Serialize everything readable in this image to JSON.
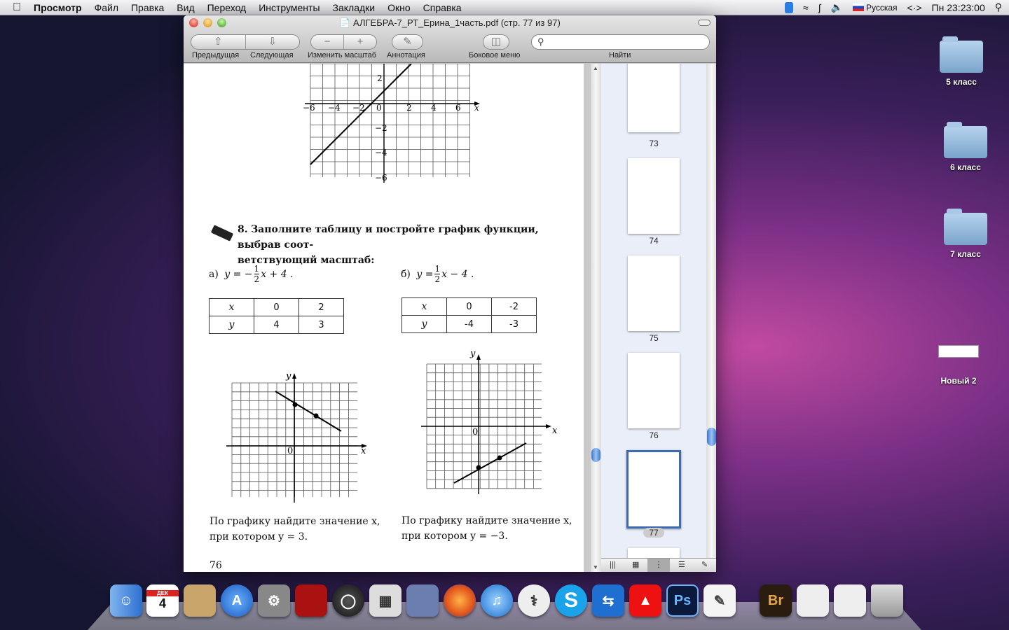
{
  "menubar": {
    "apple": "",
    "items": [
      "Просмотр",
      "Файл",
      "Правка",
      "Вид",
      "Переход",
      "Инструменты",
      "Закладки",
      "Окно",
      "Справка"
    ],
    "input_source": "Русская",
    "clock": "Пн 23:23:00"
  },
  "window": {
    "title": "АЛГЕБРА-7_РТ_Ерина_1часть.pdf (стр. 77 из 97)",
    "toolbar": {
      "prev": "Предыдущая",
      "next": "Следующая",
      "zoom": "Изменить масштаб",
      "annotate": "Аннотация",
      "sidebar": "Боковое меню",
      "find": "Найти",
      "search_value": ""
    }
  },
  "document": {
    "top_graph": {
      "x_ticks": [
        "−6",
        "−4",
        "−2",
        "0",
        "2",
        "4",
        "6"
      ],
      "y_ticks": [
        "2",
        "−2",
        "−4",
        "−6"
      ],
      "x_label": "x"
    },
    "task_number": "8.",
    "task_text_1": "Заполните таблицу и постройте график функции, выбрав соот-",
    "task_text_2": "ветствующий масштаб:",
    "part_a": {
      "label": "а)",
      "formula_pre": "y = −",
      "num": "1",
      "den": "2",
      "formula_post": "x + 4 .",
      "table": {
        "row_x": [
          "x",
          "0",
          "2"
        ],
        "row_y": [
          "y",
          "4",
          "3"
        ]
      },
      "axis_x": "x",
      "axis_y": "y",
      "origin": "0",
      "question_1": "По графику найдите значение x,",
      "question_2": "при котором y = 3."
    },
    "part_b": {
      "label": "б)",
      "formula_pre": "y = ",
      "num": "1",
      "den": "2",
      "formula_post": "x − 4 .",
      "table": {
        "row_x": [
          "x",
          "0",
          "-2"
        ],
        "row_y": [
          "y",
          "-4",
          "-3"
        ]
      },
      "axis_x": "x",
      "axis_y": "y",
      "origin": "0",
      "question_1": "По графику найдите значение x,",
      "question_2": "при котором y = −3."
    },
    "page_number": "76"
  },
  "sidebar": {
    "thumbnails": [
      "73",
      "74",
      "75",
      "76",
      "77"
    ],
    "selected": "77"
  },
  "desktop": {
    "icons": [
      "5 класс",
      "6 класс",
      "7 класс",
      "Новый 2"
    ]
  },
  "dock": {
    "calendar_month": "ДЕК",
    "calendar_day": "4",
    "bridge": "Br",
    "photoshop": "Ps"
  }
}
